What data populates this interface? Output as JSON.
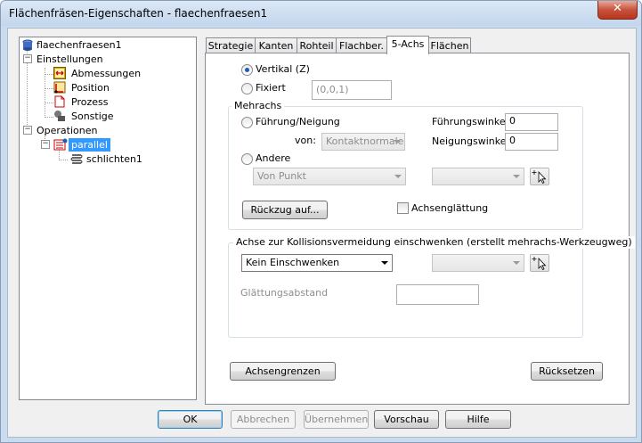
{
  "window": {
    "title": "Flächenfräsen-Eigenschaften - flaechenfraesen1",
    "close_label": "✕"
  },
  "tree": {
    "root": "flaechenfraesen1",
    "settings": "Einstellungen",
    "settings_items": [
      "Abmessungen",
      "Position",
      "Prozess",
      "Sonstige"
    ],
    "operations": "Operationen",
    "op_parallel": "parallel",
    "op_child": "schlichten1",
    "expander_minus": "−"
  },
  "tabs": [
    "Strategie",
    "Kanten",
    "Rohteil",
    "Flachber.",
    "5-Achs",
    "Flächen"
  ],
  "active_tab": "5-Achs",
  "axis": {
    "vertical_label": "Vertikal (Z)",
    "fixed_label": "Fixiert",
    "fixed_value": "(0,0,1)"
  },
  "mehrachs": {
    "group_label": "Mehrachs",
    "lead_tilt_label": "Führung/Neigung",
    "von_label": "von:",
    "von_value": "Kontaktnormale",
    "lead_angle_label": "Führungswinkel",
    "lead_angle_value": "0",
    "tilt_angle_label": "Neigungswinkel",
    "tilt_angle_value": "0",
    "other_label": "Andere",
    "other_value": "Von Punkt",
    "other_value2": "",
    "retract_button": "Rückzug auf...",
    "smoothing_label": "Achsenglättung"
  },
  "collision": {
    "group_label": "Achse zur Kollisionsvermeidung einschwenken (erstellt mehrachs-Werkzeugweg)",
    "mode_value": "Kein Einschwenken",
    "mode_value2": "",
    "smooth_dist_label": "Glättungsabstand",
    "smooth_dist_value": ""
  },
  "panel_buttons": {
    "limits": "Achsengrenzen",
    "reset": "Rücksetzen"
  },
  "footer": {
    "ok": "OK",
    "cancel": "Abbrechen",
    "apply": "Übernehmen",
    "preview": "Vorschau",
    "help": "Hilfe"
  }
}
